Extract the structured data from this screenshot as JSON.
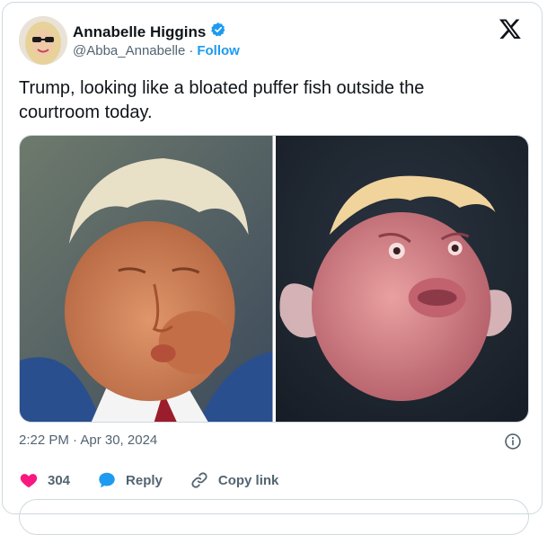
{
  "author": {
    "name": "Annabelle Higgins",
    "handle": "@Abba_Annabelle",
    "separator": "·",
    "follow_label": "Follow",
    "verified": true
  },
  "tweet": {
    "text": "Trump, looking like a bloated puffer fish outside the courtroom today.",
    "timestamp": "2:22 PM · Apr 30, 2024"
  },
  "media": {
    "images": [
      {
        "name": "man-photo"
      },
      {
        "name": "fish-photo"
      }
    ]
  },
  "actions": {
    "likes": "304",
    "reply_label": "Reply",
    "copy_label": "Copy link"
  },
  "colors": {
    "accent": "#1d9bf0",
    "like": "#f91880",
    "text": "#0f1419",
    "muted": "#536471"
  }
}
